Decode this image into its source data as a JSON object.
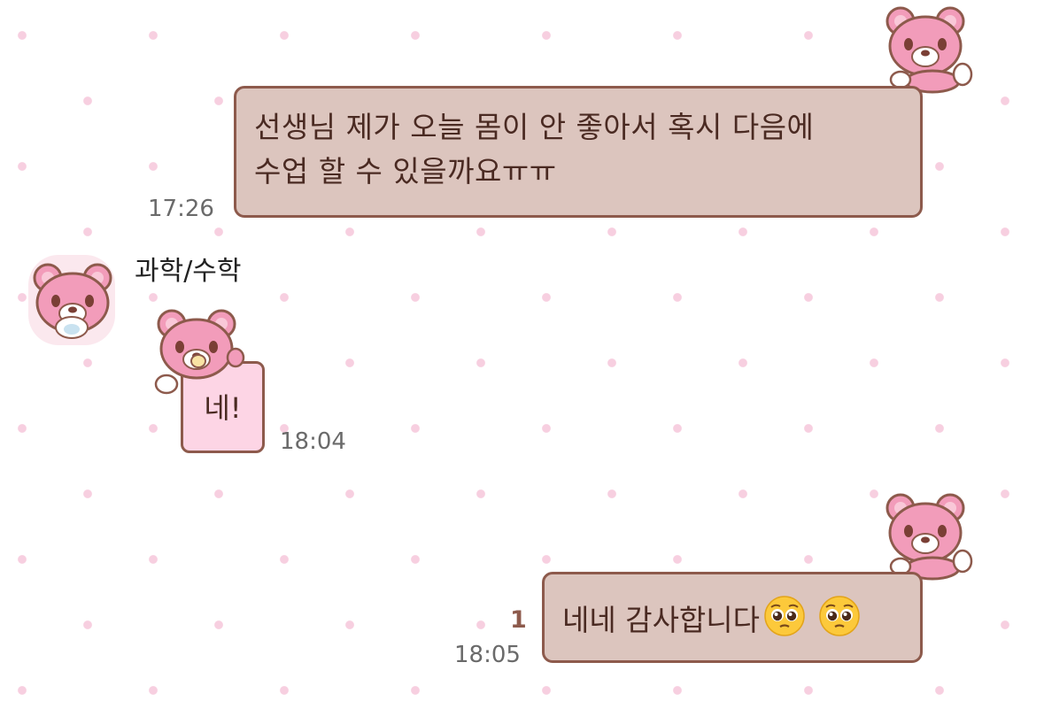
{
  "messages": [
    {
      "direction": "sent",
      "lines": [
        "선생님 제가 오늘 몸이 안 좋아서 혹시 다음에",
        "수업 할 수 있을까요ㅠㅠ"
      ],
      "time": "17:26"
    },
    {
      "direction": "received",
      "sender": "과학/수학",
      "type": "sticker",
      "sticker_text": "네!",
      "time": "18:04"
    },
    {
      "direction": "sent",
      "text": "네네 감사합니다",
      "emojis": [
        "pleading-face-emoji",
        "pleading-face-emoji"
      ],
      "unread_count": "1",
      "time": "18:05"
    }
  ],
  "colors": {
    "sent_bubble_bg": "#dcc5be",
    "sent_bubble_border": "#8d5a4c",
    "bear_pink": "#f29cba",
    "background_dot": "#f7cfe0",
    "sticker_card_bg": "#fdd5e5"
  }
}
